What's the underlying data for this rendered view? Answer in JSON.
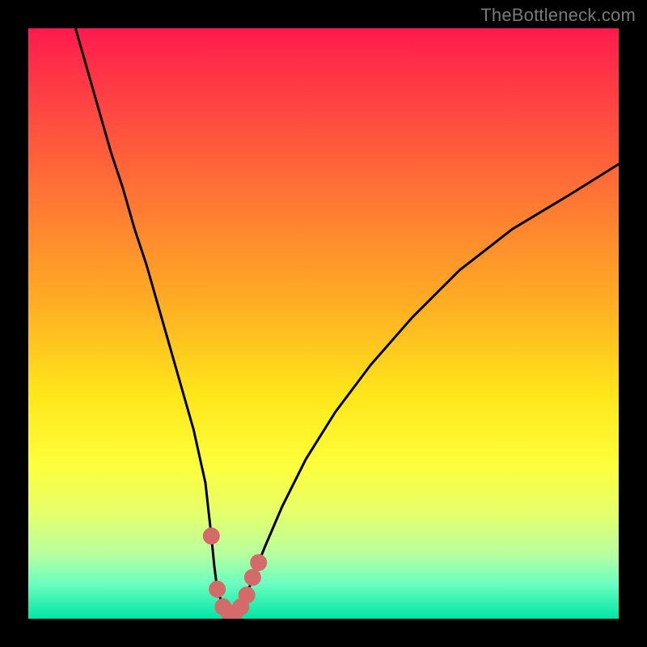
{
  "watermark": "TheBottleneck.com",
  "colors": {
    "curve_stroke": "#000000",
    "marker_stroke": "#d46a6a",
    "marker_fill": "#d46a6a"
  },
  "chart_data": {
    "type": "line",
    "title": "",
    "xlabel": "",
    "ylabel": "",
    "xlim": [
      0,
      100
    ],
    "ylim": [
      0,
      100
    ],
    "series": [
      {
        "name": "bottleneck-curve",
        "x": [
          8,
          10,
          12,
          14,
          16,
          18,
          20,
          22,
          24,
          26,
          28,
          30,
          31,
          31.5,
          32,
          33,
          34,
          35,
          36,
          37,
          38,
          40,
          43,
          47,
          52,
          58,
          65,
          73,
          82,
          92,
          100
        ],
        "y": [
          100,
          93,
          86,
          79,
          73,
          66,
          60,
          53,
          46,
          39,
          32,
          23,
          14,
          9,
          5,
          2,
          1,
          1,
          2,
          4,
          7,
          12,
          19,
          27,
          35,
          43,
          51,
          59,
          66,
          72,
          77
        ]
      }
    ],
    "markers": {
      "name": "highlight-dots",
      "points": [
        {
          "x": 31.0,
          "y": 14
        },
        {
          "x": 32.0,
          "y": 5
        },
        {
          "x": 33.0,
          "y": 2
        },
        {
          "x": 34.0,
          "y": 1
        },
        {
          "x": 35.0,
          "y": 1
        },
        {
          "x": 36.0,
          "y": 2
        },
        {
          "x": 37.0,
          "y": 4
        },
        {
          "x": 38.0,
          "y": 7
        },
        {
          "x": 39.0,
          "y": 9.5
        }
      ]
    }
  }
}
